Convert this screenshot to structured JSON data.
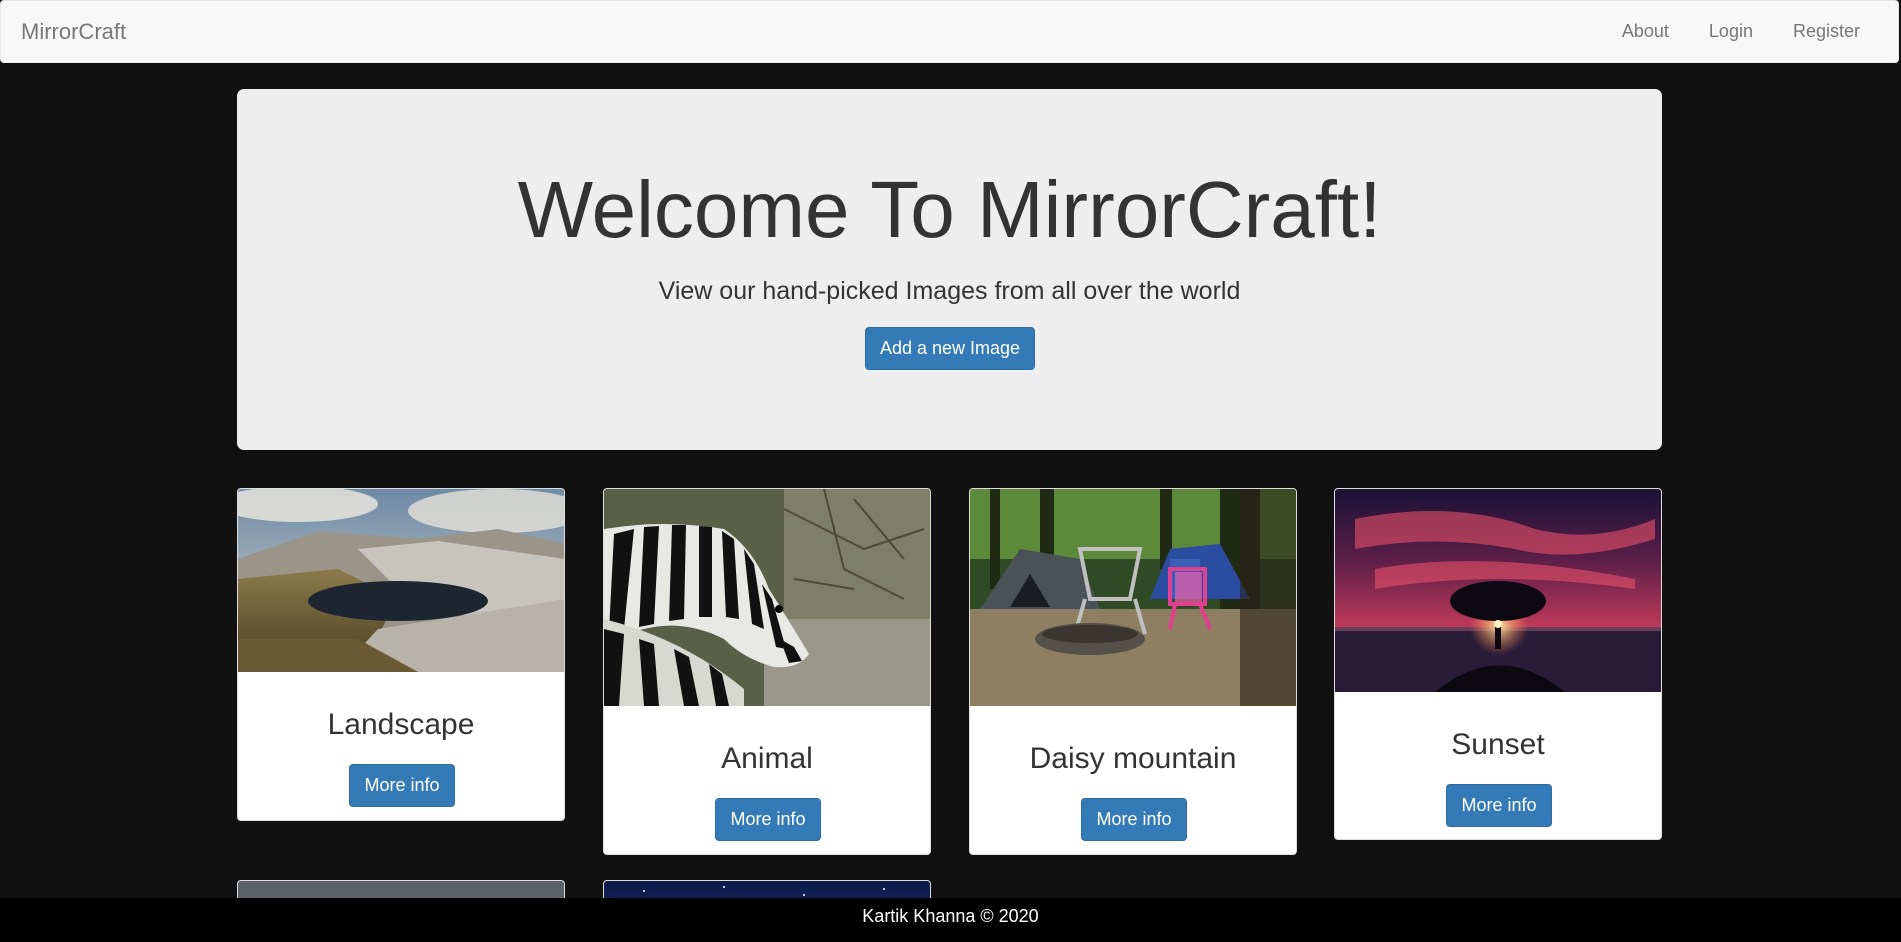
{
  "navbar": {
    "brand": "MirrorCraft",
    "links": [
      "About",
      "Login",
      "Register"
    ]
  },
  "jumbotron": {
    "title": "Welcome To MirrorCraft!",
    "subtitle": "View our hand-picked Images from all over the world",
    "button": "Add a new Image"
  },
  "cards": [
    {
      "title": "Landscape",
      "button": "More info"
    },
    {
      "title": "Animal",
      "button": "More info"
    },
    {
      "title": "Daisy mountain",
      "button": "More info"
    },
    {
      "title": "Sunset",
      "button": "More info"
    }
  ],
  "footer": {
    "text": "Kartik Khanna © 2020"
  },
  "colors": {
    "primary": "#337ab7",
    "background": "#111111",
    "jumbotron": "#eeeeee"
  }
}
